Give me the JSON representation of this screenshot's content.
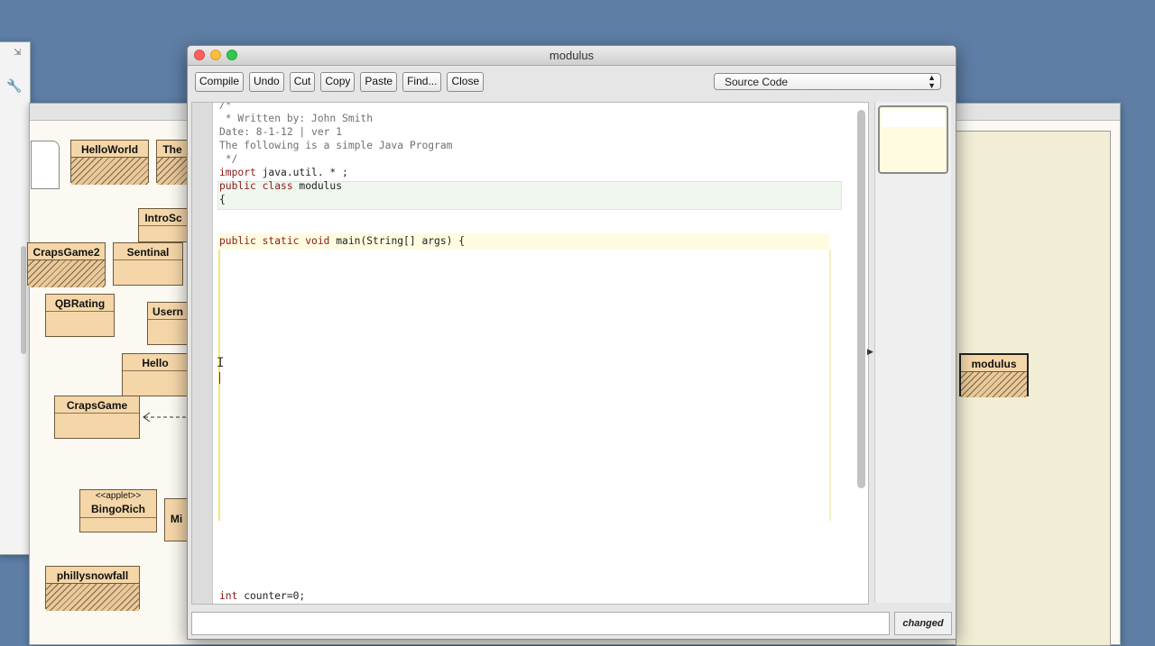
{
  "editor": {
    "title": "modulus",
    "toolbar": {
      "compile": "Compile",
      "undo": "Undo",
      "cut": "Cut",
      "copy": "Copy",
      "paste": "Paste",
      "find": "Find...",
      "close": "Close"
    },
    "view_select": "Source Code",
    "status": "changed",
    "code": {
      "l1": "/*",
      "l2": " * Written by: John Smith",
      "l3": "Date: 8-1-12 | ver 1",
      "l4": "The following is a simple Java Program",
      "l5": " */",
      "l6_kw": "import",
      "l6_rest": " java.util. * ;",
      "l7_kw1": "public class",
      "l7_rest": " modulus",
      "l8": "{",
      "l9_kw": "public static void",
      "l9_rest": " main(String[] args) {",
      "l10_kw": "int",
      "l10_rest": " counter=0;"
    }
  },
  "diagram": {
    "classes": {
      "helloworld": "HelloWorld",
      "the": "The",
      "introsc": "IntroSc",
      "crapsgame2": "CrapsGame2",
      "sentinal": "Sentinal",
      "qbrating": "QBRating",
      "usern": "Usern",
      "hello": "Hello",
      "crapsgame": "CrapsGame",
      "bingorich_stereo": "<<applet>>",
      "bingorich": "BingoRich",
      "mi": "Mi",
      "phillysnowfall": "phillysnowfall",
      "modulus": "modulus"
    }
  },
  "colors": {
    "desktop": "#5e7ea6",
    "class_fill": "#f4d6a8",
    "keyword": "#8b1a1a",
    "comment": "#707070"
  }
}
